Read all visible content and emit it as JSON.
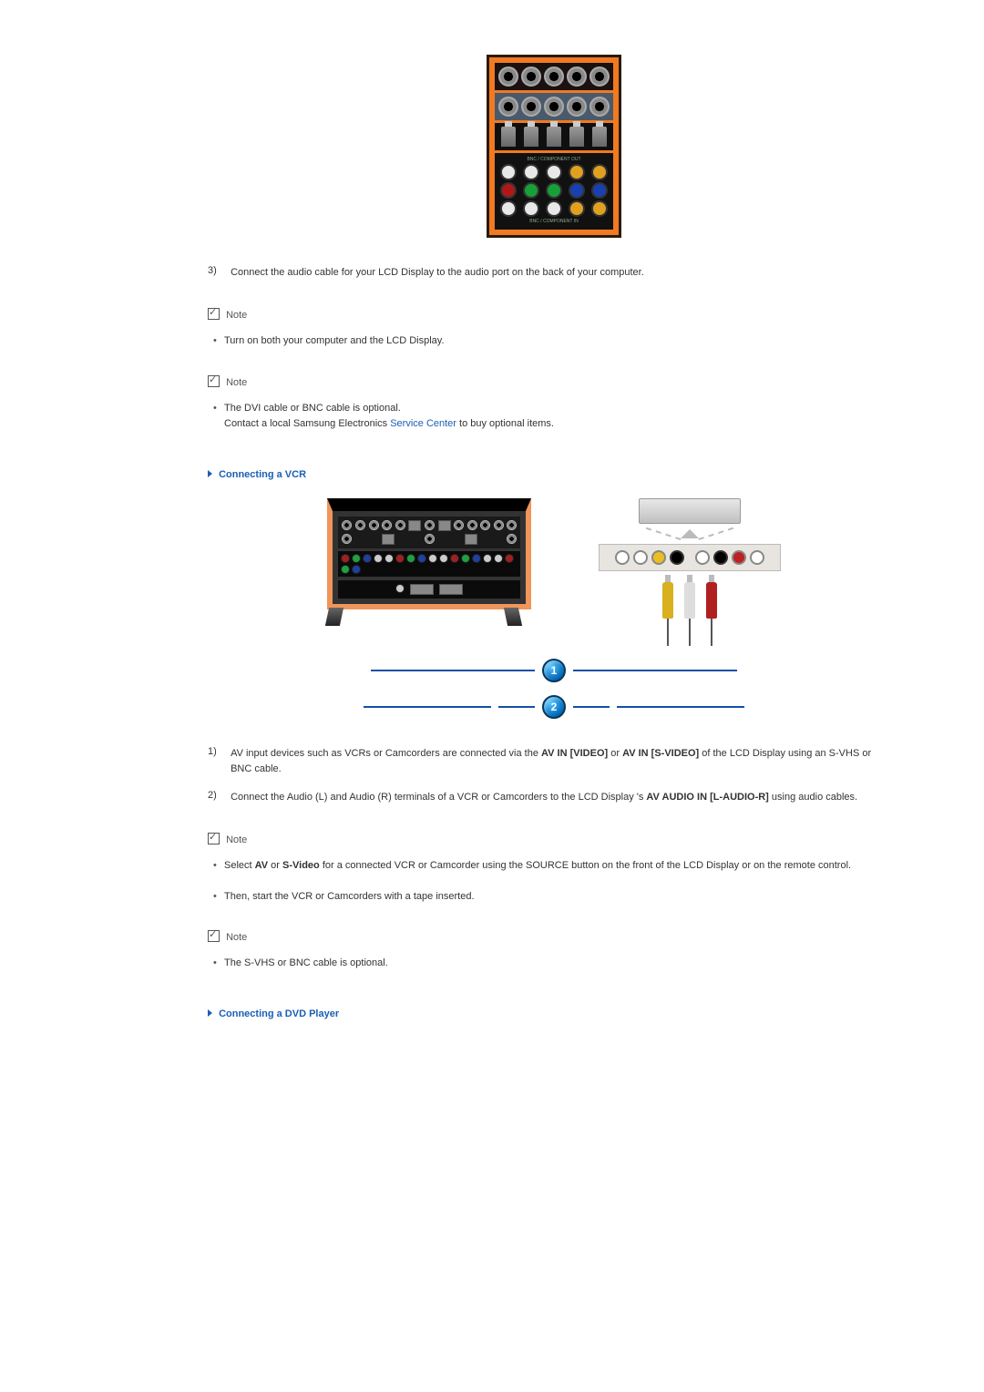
{
  "image1": {
    "top_label": "BNC / COMPONENT OUT",
    "bottom_label": "BNC / COMPONENT IN"
  },
  "step3": {
    "num": "3)",
    "text": "Connect the audio cable for your LCD Display to the audio port on the back of your computer."
  },
  "note1": {
    "label": "Note",
    "bullet1": "Turn on both your computer and the LCD Display."
  },
  "note2": {
    "label": "Note",
    "bullet1_a": "The DVI cable or BNC cable is optional.",
    "bullet1_b_pre": "Contact a local Samsung Electronics ",
    "bullet1_b_link": "Service Center",
    "bullet1_b_post": " to buy optional items."
  },
  "section_vcr": {
    "title": "Connecting a VCR"
  },
  "vcr_steps": {
    "s1": {
      "num": "1)",
      "pre": "AV input devices such as VCRs or Camcorders are connected via the ",
      "b1": "AV IN [VIDEO]",
      "mid": " or ",
      "b2": "AV IN [S-VIDEO]",
      "post": " of the LCD Display using an S-VHS or BNC cable."
    },
    "s2": {
      "num": "2)",
      "pre": "Connect the Audio (L) and Audio (R) terminals of a VCR or Camcorders to the LCD Display 's ",
      "b": "AV AUDIO IN [L-AUDIO-R]",
      "post": " using audio cables."
    }
  },
  "note3": {
    "label": "Note",
    "bullet1_pre": "Select ",
    "bullet1_b1": "AV",
    "bullet1_mid": " or ",
    "bullet1_b2": "S-Video",
    "bullet1_post": " for a connected VCR or Camcorder using the SOURCE button on the front of the LCD Display or on the remote control.",
    "bullet2": "Then, start the VCR or Camcorders with a tape inserted."
  },
  "note4": {
    "label": "Note",
    "bullet1": "The S-VHS or BNC cable is optional."
  },
  "section_dvd": {
    "title": "Connecting a DVD Player"
  },
  "badges": {
    "one": "1",
    "two": "2"
  }
}
